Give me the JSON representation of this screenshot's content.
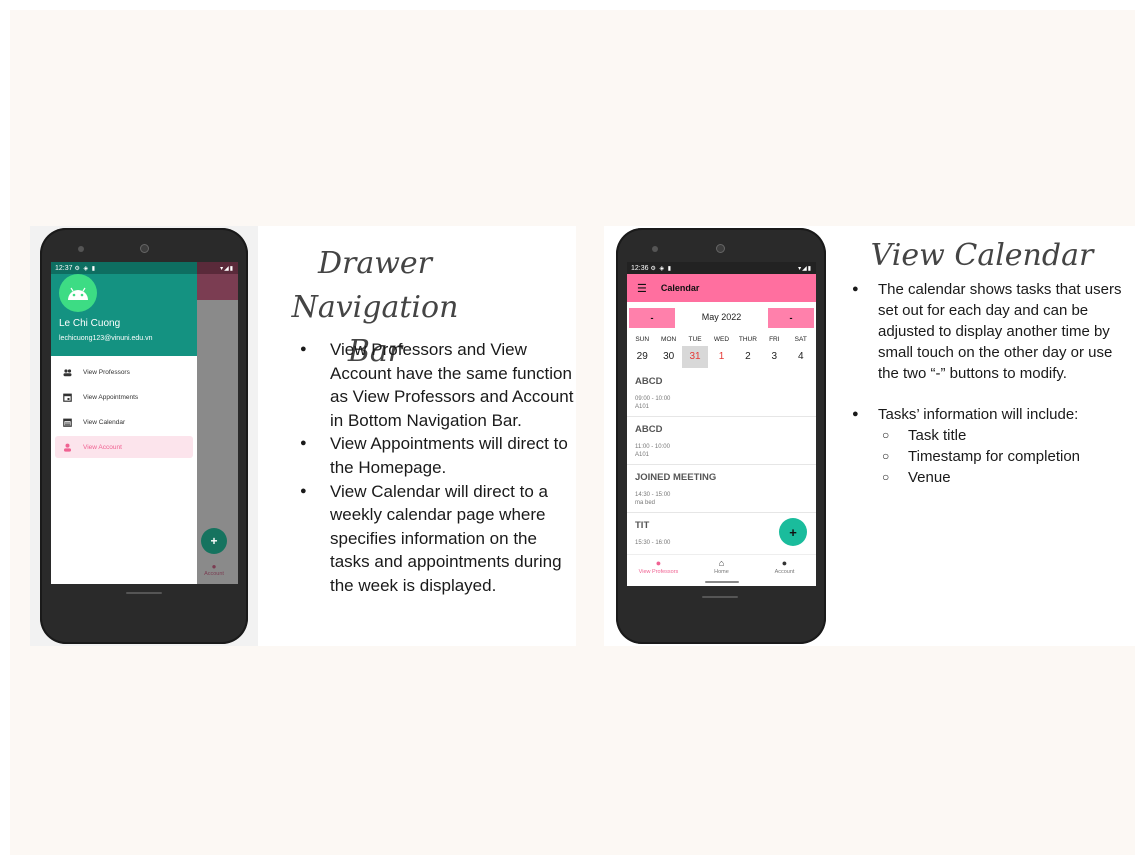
{
  "left": {
    "title_line1": "Drawer",
    "title_line2": "Navigation Bar",
    "status_time": "12:37",
    "status_icons": "⚙ ◈ ▮",
    "status_right": "▾◢▮",
    "user_name": "Le Chi Cuong",
    "user_email": "lechicuong123@vinuni.edu.vn",
    "menu": [
      {
        "label": "View Professors",
        "icon": "people-icon"
      },
      {
        "label": "View Appointments",
        "icon": "calendar-check-icon"
      },
      {
        "label": "View Calendar",
        "icon": "calendar-icon"
      },
      {
        "label": "View Account",
        "icon": "person-icon"
      }
    ],
    "fab_label": "+",
    "behind_tab_label": "Account",
    "bullets": [
      "View Professors and View Account have the same function as View Professors and Account in Bottom Navigation Bar.",
      "View Appointments will direct to the Homepage.",
      "View Calendar will direct to a weekly calendar page where specifies information on the tasks and appointments during the week is displayed."
    ]
  },
  "right": {
    "title": "View Calendar",
    "status_time": "12:36",
    "status_icons": "⚙ ◈ ▮",
    "status_right": "▾◢▮",
    "app_title": "Calendar",
    "prev_btn": "-",
    "next_btn": "-",
    "month": "May 2022",
    "days": [
      "SUN",
      "MON",
      "TUE",
      "WED",
      "THUR",
      "FRI",
      "SAT"
    ],
    "dates": [
      "29",
      "30",
      "31",
      "1",
      "2",
      "3",
      "4"
    ],
    "tasks": [
      {
        "title": "ABCD",
        "time": "09:00 - 10:00",
        "venue": "A101"
      },
      {
        "title": "ABCD",
        "time": "11:00 - 10:00",
        "venue": "A101"
      },
      {
        "title": "JOINED MEETING",
        "time": "14:30 - 15:00",
        "venue": "ma bed"
      },
      {
        "title": "TIT",
        "time": "15:30 - 16:00",
        "venue": ""
      }
    ],
    "fab_label": "+",
    "nav": [
      {
        "label": "View Professors",
        "icon": "person-icon"
      },
      {
        "label": "Home",
        "icon": "home-icon"
      },
      {
        "label": "Account",
        "icon": "person-icon"
      }
    ],
    "bullets": [
      "The calendar shows tasks that users set out for each day and can be adjusted to display another time by small touch on the other day or use the two “-” buttons to modify.",
      "Tasks’ information will include:"
    ],
    "sub_bullets": [
      "Task title",
      "Timestamp for completion",
      "Venue"
    ]
  },
  "colors": {
    "drawer_header": "#149281",
    "calendar_pink": "#ff6f9f",
    "fab_teal": "#1abc9c",
    "active_pink": "#f06292"
  }
}
